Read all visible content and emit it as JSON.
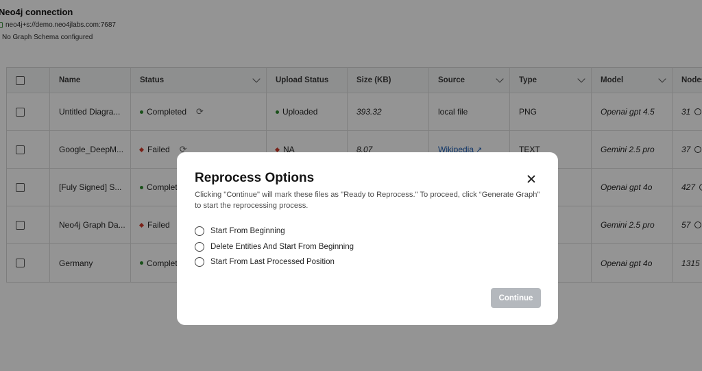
{
  "connection": {
    "title": "Neo4j connection",
    "url": "neo4j+s://demo.neo4jlabs.com:7687",
    "schema": "No Graph Schema configured"
  },
  "table": {
    "headers": [
      "Name",
      "Status",
      "Upload Status",
      "Size (KB)",
      "Source",
      "Type",
      "Model",
      "Nodes"
    ],
    "rows": [
      {
        "name": "Untitled Diagra...",
        "status": "Completed",
        "upload": "Uploaded",
        "size": "393.32",
        "source": "local file",
        "type": "PNG",
        "model": "Openai gpt 4.5",
        "nodes": "31"
      },
      {
        "name": "Google_DeepM...",
        "status": "Failed",
        "upload": "NA",
        "size": "8.07",
        "source": "Wikipedia",
        "type": "TEXT",
        "model": "Gemini 2.5 pro",
        "nodes": "37"
      },
      {
        "name": "[Fuly Signed] S...",
        "status": "Complet",
        "upload": "",
        "size": "",
        "source": "",
        "type": "",
        "model": "Openai gpt 4o",
        "nodes": "427"
      },
      {
        "name": "Neo4j Graph Da...",
        "status": "Failed",
        "upload": "",
        "size": "",
        "source": "",
        "type": "",
        "model": "Gemini 2.5 pro",
        "nodes": "57"
      },
      {
        "name": "Germany",
        "status": "Complet",
        "upload": "",
        "size": "",
        "source": "",
        "type": "",
        "model": "Openai gpt 4o",
        "nodes": "1315"
      }
    ]
  },
  "modal": {
    "title": "Reprocess Options",
    "description": "Clicking \"Continue\" will mark these files as \"Ready to Reprocess.\" To proceed, click “Generate Graph” to start the reprocessing process.",
    "options": [
      "Start From Beginning",
      "Delete Entities And Start From Beginning",
      "Start From Last Processed Position"
    ],
    "continue_label": "Continue"
  },
  "colors": {
    "completed": "#2e8b2e",
    "failed": "#d13a2a",
    "link": "#1f5fb5",
    "continue_disabled": "#b4b8bd"
  }
}
